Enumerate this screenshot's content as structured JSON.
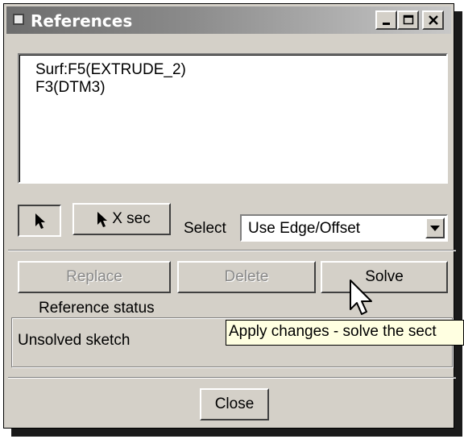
{
  "window": {
    "title": "References",
    "controls": {
      "minimize": "_",
      "maximize": "□",
      "close": "×"
    }
  },
  "references": {
    "items": [
      "Surf:F5(EXTRUDE_2)",
      "F3(DTM3)"
    ]
  },
  "tools": {
    "xsec_label": "X sec",
    "select_label": "Select",
    "select_value": "Use Edge/Offset"
  },
  "actions": {
    "replace": "Replace",
    "delete": "Delete",
    "solve": "Solve"
  },
  "status": {
    "group_title": "Reference status",
    "text": "Unsolved sketch"
  },
  "tooltip": "Apply changes - solve the sect",
  "footer": {
    "close": "Close"
  },
  "icons": {
    "title": "window-icon",
    "select_arrow": "arrow-cursor-icon",
    "dropdown": "chevron-down-icon",
    "pointer": "mouse-pointer-icon"
  }
}
